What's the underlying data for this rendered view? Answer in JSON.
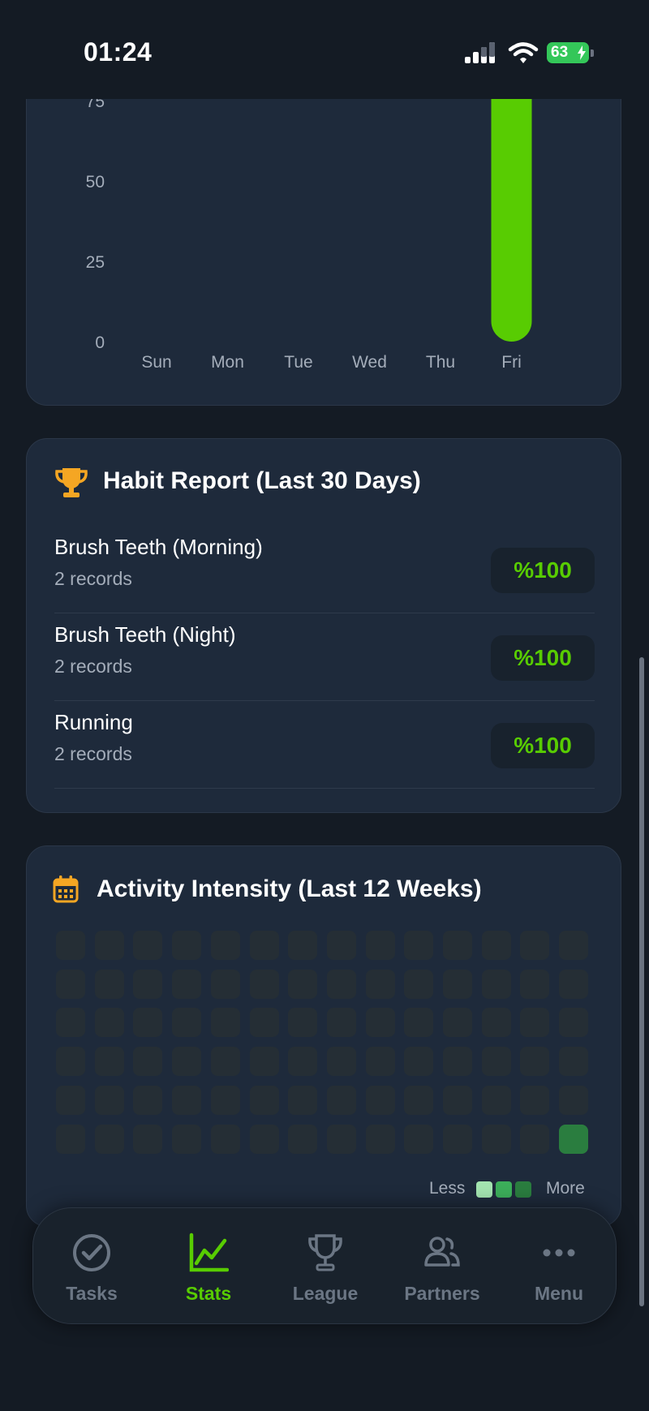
{
  "status_bar": {
    "time": "01:24",
    "battery": "63"
  },
  "weekly_chart": {
    "chart_data": {
      "type": "bar",
      "categories": [
        "Sun",
        "Mon",
        "Tue",
        "Wed",
        "Thu",
        "Fri"
      ],
      "values": [
        0,
        0,
        0,
        0,
        0,
        100
      ],
      "y_ticks": [
        "0",
        "25",
        "50",
        "75"
      ],
      "ylim": [
        0,
        100
      ],
      "color": "#58cc02"
    }
  },
  "habit_report": {
    "title": "Habit Report (Last 30 Days)",
    "icon": "trophy-icon",
    "icon_color": "#f5a623",
    "habits": [
      {
        "name": "Brush Teeth (Morning)",
        "records": "2 records",
        "percent": "%100"
      },
      {
        "name": "Brush Teeth (Night)",
        "records": "2 records",
        "percent": "%100"
      },
      {
        "name": "Running",
        "records": "2 records",
        "percent": "%100"
      }
    ]
  },
  "activity": {
    "title": "Activity Intensity (Last 12 Weeks)",
    "icon": "calendar-icon",
    "icon_color": "#f5a623",
    "rows": 6,
    "cols": 14,
    "active_cells": [
      [
        5,
        13
      ]
    ],
    "legend": {
      "less": "Less",
      "more": "More",
      "colors": [
        "#a3e4b0",
        "#3cae5a",
        "#2a7d3f"
      ]
    }
  },
  "tab_bar": {
    "tabs": [
      {
        "label": "Tasks",
        "icon": "check-circle-icon",
        "active": false
      },
      {
        "label": "Stats",
        "icon": "chart-line-icon",
        "active": true
      },
      {
        "label": "League",
        "icon": "trophy-icon",
        "active": false
      },
      {
        "label": "Partners",
        "icon": "partners-icon",
        "active": false
      },
      {
        "label": "Menu",
        "icon": "more-icon",
        "active": false
      }
    ],
    "active_color": "#58cc02"
  }
}
